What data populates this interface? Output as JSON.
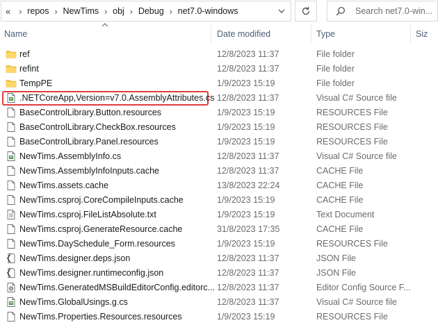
{
  "breadcrumb": {
    "lead": "«",
    "parts": [
      "repos",
      "NewTims",
      "obj",
      "Debug",
      "net7.0-windows"
    ]
  },
  "search": {
    "placeholder": "Search net7.0-win..."
  },
  "columns": {
    "name": "Name",
    "date": "Date modified",
    "type": "Type",
    "size": "Siz"
  },
  "colors": {
    "folder": "#f4c542",
    "highlight": "#e03c3c",
    "csfile": "#3c8f3c"
  },
  "files": [
    {
      "name": "ref",
      "date": "12/8/2023 11:37",
      "type": "File folder",
      "icon": "folder-icon"
    },
    {
      "name": "refint",
      "date": "12/8/2023 11:37",
      "type": "File folder",
      "icon": "folder-icon"
    },
    {
      "name": "TempPE",
      "date": "1/9/2023 15:19",
      "type": "File folder",
      "icon": "folder-icon"
    },
    {
      "name": ".NETCoreApp,Version=v7.0.AssemblyAttributes.cs",
      "date": "12/8/2023 11:37",
      "type": "Visual C# Source file",
      "icon": "csharp-file-icon",
      "highlighted": true
    },
    {
      "name": "BaseControlLibrary.Button.resources",
      "date": "1/9/2023 15:19",
      "type": "RESOURCES File",
      "icon": "file-icon"
    },
    {
      "name": "BaseControlLibrary.CheckBox.resources",
      "date": "1/9/2023 15:19",
      "type": "RESOURCES File",
      "icon": "file-icon"
    },
    {
      "name": "BaseControlLibrary.Panel.resources",
      "date": "1/9/2023 15:19",
      "type": "RESOURCES File",
      "icon": "file-icon"
    },
    {
      "name": "NewTims.AssemblyInfo.cs",
      "date": "12/8/2023 11:37",
      "type": "Visual C# Source file",
      "icon": "csharp-file-icon"
    },
    {
      "name": "NewTims.AssemblyInfoInputs.cache",
      "date": "12/8/2023 11:37",
      "type": "CACHE File",
      "icon": "file-icon"
    },
    {
      "name": "NewTims.assets.cache",
      "date": "13/8/2023 22:24",
      "type": "CACHE File",
      "icon": "file-icon"
    },
    {
      "name": "NewTims.csproj.CoreCompileInputs.cache",
      "date": "1/9/2023 15:19",
      "type": "CACHE File",
      "icon": "file-icon"
    },
    {
      "name": "NewTims.csproj.FileListAbsolute.txt",
      "date": "1/9/2023 15:19",
      "type": "Text Document",
      "icon": "text-file-icon"
    },
    {
      "name": "NewTims.csproj.GenerateResource.cache",
      "date": "31/8/2023 17:35",
      "type": "CACHE File",
      "icon": "file-icon"
    },
    {
      "name": "NewTims.DaySchedule_Form.resources",
      "date": "1/9/2023 15:19",
      "type": "RESOURCES File",
      "icon": "file-icon"
    },
    {
      "name": "NewTims.designer.deps.json",
      "date": "12/8/2023 11:37",
      "type": "JSON File",
      "icon": "json-file-icon"
    },
    {
      "name": "NewTims.designer.runtimeconfig.json",
      "date": "12/8/2023 11:37",
      "type": "JSON File",
      "icon": "json-file-icon"
    },
    {
      "name": "NewTims.GeneratedMSBuildEditorConfig.editorc...",
      "date": "12/8/2023 11:37",
      "type": "Editor Config Source F...",
      "icon": "config-file-icon"
    },
    {
      "name": "NewTims.GlobalUsings.g.cs",
      "date": "12/8/2023 11:37",
      "type": "Visual C# Source file",
      "icon": "csharp-file-icon"
    },
    {
      "name": "NewTims.Properties.Resources.resources",
      "date": "1/9/2023 15:19",
      "type": "RESOURCES File",
      "icon": "file-icon"
    }
  ]
}
